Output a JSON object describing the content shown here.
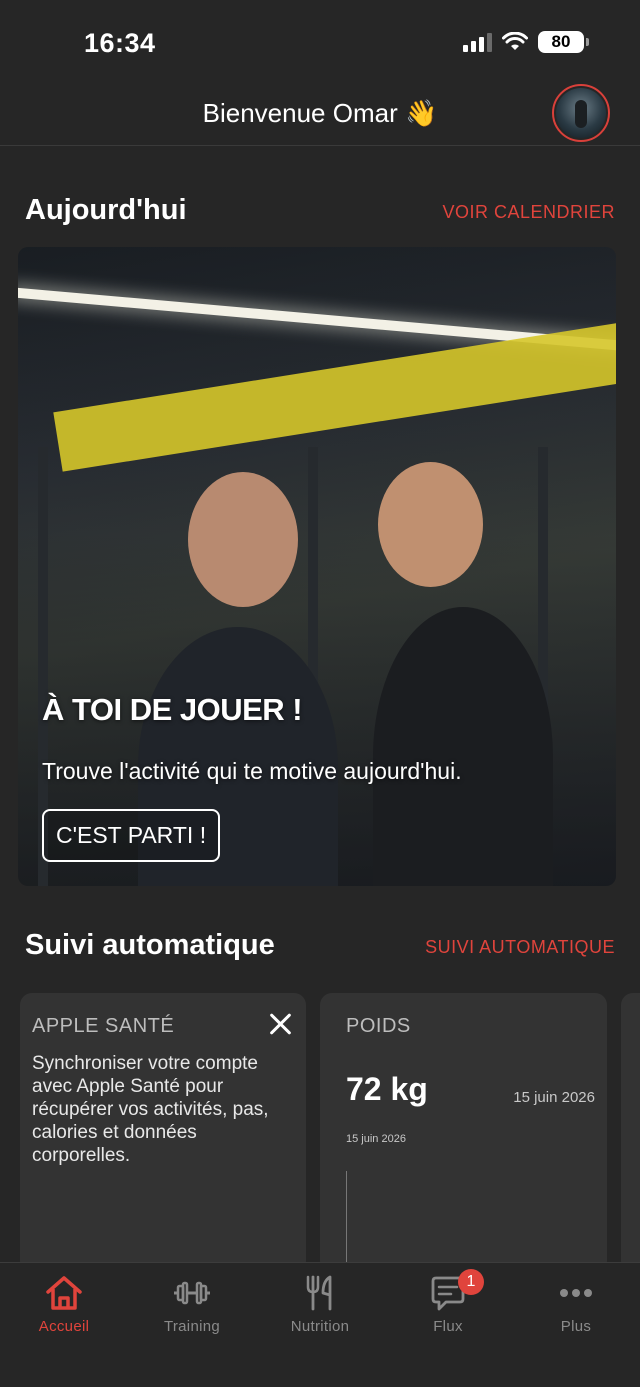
{
  "status_bar": {
    "time": "16:34",
    "battery": "80",
    "icons": [
      "cellular-signal-icon",
      "wifi-icon",
      "battery-icon"
    ]
  },
  "header": {
    "welcome": "Bienvenue Omar 👋",
    "avatar_icon": "profile-avatar"
  },
  "today": {
    "title": "Aujourd'hui",
    "link": "VOIR CALENDRIER",
    "hero": {
      "title": "À TOI DE JOUER !",
      "subtitle": "Trouve l'activité qui te motive aujourd'hui.",
      "button": "C'EST PARTI !"
    }
  },
  "tracking": {
    "title": "Suivi automatique",
    "link": "SUIVI AUTOMATIQUE",
    "apple_card": {
      "label": "APPLE SANTÉ",
      "text": "Synchroniser votre compte avec Apple Santé pour récupérer vos activités, pas, calories et données corporelles.",
      "close_icon": "close-icon"
    },
    "weight_card": {
      "label": "POIDS",
      "value": "72 kg",
      "date": "15 juin 2026",
      "chart_date": "15 juin 2026"
    }
  },
  "tabbar": {
    "items": [
      {
        "label": "Accueil",
        "icon": "home-icon",
        "active": true
      },
      {
        "label": "Training",
        "icon": "dumbbell-icon",
        "active": false
      },
      {
        "label": "Nutrition",
        "icon": "fork-knife-icon",
        "active": false
      },
      {
        "label": "Flux",
        "icon": "chat-bubble-icon",
        "active": false,
        "badge": "1"
      },
      {
        "label": "Plus",
        "icon": "more-dots-icon",
        "active": false
      }
    ]
  },
  "colors": {
    "accent": "#e0443c",
    "background": "#262626",
    "card": "#333333"
  }
}
